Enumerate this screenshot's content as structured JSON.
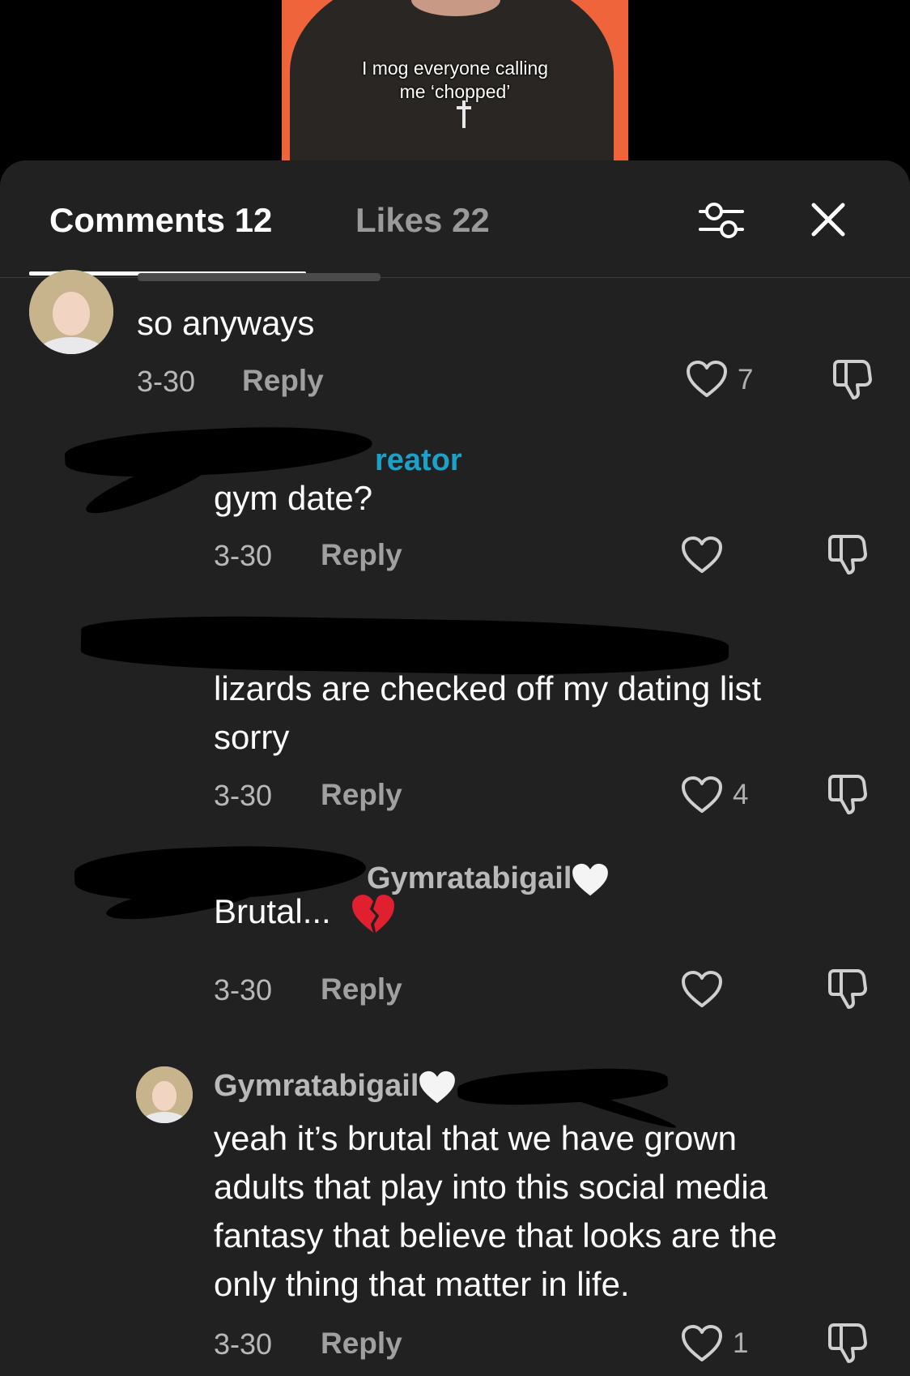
{
  "video": {
    "caption_line1": "I mog everyone calling",
    "caption_line2": "me ‘chopped’"
  },
  "tabs": {
    "comments_label": "Comments 12",
    "likes_label": "Likes 22"
  },
  "icons": {
    "filter": "sliders-icon",
    "close": "close-icon",
    "like": "heart-outline-icon",
    "dislike": "thumbs-down-icon",
    "white_heart": "white-heart-emoji",
    "broken_heart": "broken-heart-emoji"
  },
  "colors": {
    "sheet_bg": "#212121",
    "creator_label": "#1da1c9",
    "video_bg": "#f0643c"
  },
  "comments": [
    {
      "text": "so anyways",
      "date": "3-30",
      "reply_label": "Reply",
      "likes": "7"
    },
    {
      "creator_tag": "reator",
      "text": "gym date?",
      "date": "3-30",
      "reply_label": "Reply",
      "likes": ""
    },
    {
      "text_line1": "lizards are checked off my dating list",
      "text_line2": "sorry",
      "date": "3-30",
      "reply_label": "Reply",
      "likes": "4"
    },
    {
      "reply_to": "Gymratabigail",
      "text": "Brutal...",
      "date": "3-30",
      "reply_label": "Reply",
      "likes": ""
    },
    {
      "username": "Gymratabigail",
      "text_line1": "yeah it’s brutal that we have grown",
      "text_line2": "adults that play into this social media",
      "text_line3": "fantasy that believe that looks are the",
      "text_line4": "only thing that matter in life.",
      "date": "3-30",
      "reply_label": "Reply",
      "likes": "1"
    }
  ]
}
